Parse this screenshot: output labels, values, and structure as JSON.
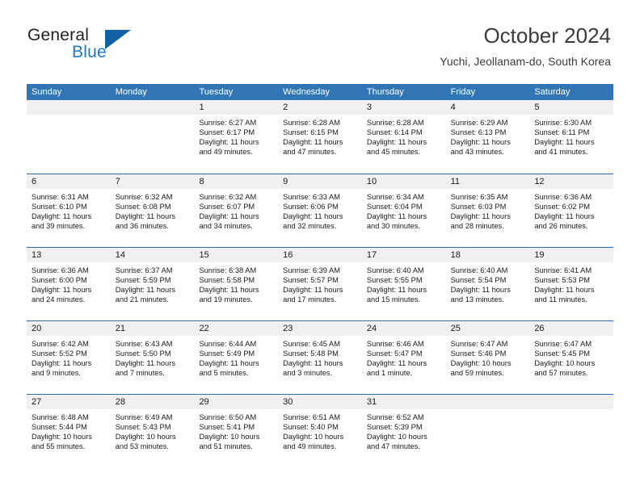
{
  "logo": {
    "word_top": "General",
    "word_bottom": "Blue",
    "triangle_color": "#1362a6",
    "blue_color": "#1c79c0"
  },
  "header": {
    "title": "October 2024",
    "subtitle": "Yuchi, Jeollanam-do, South Korea",
    "accent_color": "#3275b5"
  },
  "weekday_headers": [
    "Sunday",
    "Monday",
    "Tuesday",
    "Wednesday",
    "Thursday",
    "Friday",
    "Saturday"
  ],
  "weeks": [
    [
      {
        "day": "",
        "sunrise": "",
        "sunset": "",
        "daylight_line1": "",
        "daylight_line2": "",
        "empty": true
      },
      {
        "day": "",
        "sunrise": "",
        "sunset": "",
        "daylight_line1": "",
        "daylight_line2": "",
        "empty": true
      },
      {
        "day": "1",
        "sunrise": "Sunrise: 6:27 AM",
        "sunset": "Sunset: 6:17 PM",
        "daylight_line1": "Daylight: 11 hours",
        "daylight_line2": "and 49 minutes."
      },
      {
        "day": "2",
        "sunrise": "Sunrise: 6:28 AM",
        "sunset": "Sunset: 6:15 PM",
        "daylight_line1": "Daylight: 11 hours",
        "daylight_line2": "and 47 minutes."
      },
      {
        "day": "3",
        "sunrise": "Sunrise: 6:28 AM",
        "sunset": "Sunset: 6:14 PM",
        "daylight_line1": "Daylight: 11 hours",
        "daylight_line2": "and 45 minutes."
      },
      {
        "day": "4",
        "sunrise": "Sunrise: 6:29 AM",
        "sunset": "Sunset: 6:13 PM",
        "daylight_line1": "Daylight: 11 hours",
        "daylight_line2": "and 43 minutes."
      },
      {
        "day": "5",
        "sunrise": "Sunrise: 6:30 AM",
        "sunset": "Sunset: 6:11 PM",
        "daylight_line1": "Daylight: 11 hours",
        "daylight_line2": "and 41 minutes."
      }
    ],
    [
      {
        "day": "6",
        "sunrise": "Sunrise: 6:31 AM",
        "sunset": "Sunset: 6:10 PM",
        "daylight_line1": "Daylight: 11 hours",
        "daylight_line2": "and 39 minutes."
      },
      {
        "day": "7",
        "sunrise": "Sunrise: 6:32 AM",
        "sunset": "Sunset: 6:08 PM",
        "daylight_line1": "Daylight: 11 hours",
        "daylight_line2": "and 36 minutes."
      },
      {
        "day": "8",
        "sunrise": "Sunrise: 6:32 AM",
        "sunset": "Sunset: 6:07 PM",
        "daylight_line1": "Daylight: 11 hours",
        "daylight_line2": "and 34 minutes."
      },
      {
        "day": "9",
        "sunrise": "Sunrise: 6:33 AM",
        "sunset": "Sunset: 6:06 PM",
        "daylight_line1": "Daylight: 11 hours",
        "daylight_line2": "and 32 minutes."
      },
      {
        "day": "10",
        "sunrise": "Sunrise: 6:34 AM",
        "sunset": "Sunset: 6:04 PM",
        "daylight_line1": "Daylight: 11 hours",
        "daylight_line2": "and 30 minutes."
      },
      {
        "day": "11",
        "sunrise": "Sunrise: 6:35 AM",
        "sunset": "Sunset: 6:03 PM",
        "daylight_line1": "Daylight: 11 hours",
        "daylight_line2": "and 28 minutes."
      },
      {
        "day": "12",
        "sunrise": "Sunrise: 6:36 AM",
        "sunset": "Sunset: 6:02 PM",
        "daylight_line1": "Daylight: 11 hours",
        "daylight_line2": "and 26 minutes."
      }
    ],
    [
      {
        "day": "13",
        "sunrise": "Sunrise: 6:36 AM",
        "sunset": "Sunset: 6:00 PM",
        "daylight_line1": "Daylight: 11 hours",
        "daylight_line2": "and 24 minutes."
      },
      {
        "day": "14",
        "sunrise": "Sunrise: 6:37 AM",
        "sunset": "Sunset: 5:59 PM",
        "daylight_line1": "Daylight: 11 hours",
        "daylight_line2": "and 21 minutes."
      },
      {
        "day": "15",
        "sunrise": "Sunrise: 6:38 AM",
        "sunset": "Sunset: 5:58 PM",
        "daylight_line1": "Daylight: 11 hours",
        "daylight_line2": "and 19 minutes."
      },
      {
        "day": "16",
        "sunrise": "Sunrise: 6:39 AM",
        "sunset": "Sunset: 5:57 PM",
        "daylight_line1": "Daylight: 11 hours",
        "daylight_line2": "and 17 minutes."
      },
      {
        "day": "17",
        "sunrise": "Sunrise: 6:40 AM",
        "sunset": "Sunset: 5:55 PM",
        "daylight_line1": "Daylight: 11 hours",
        "daylight_line2": "and 15 minutes."
      },
      {
        "day": "18",
        "sunrise": "Sunrise: 6:40 AM",
        "sunset": "Sunset: 5:54 PM",
        "daylight_line1": "Daylight: 11 hours",
        "daylight_line2": "and 13 minutes."
      },
      {
        "day": "19",
        "sunrise": "Sunrise: 6:41 AM",
        "sunset": "Sunset: 5:53 PM",
        "daylight_line1": "Daylight: 11 hours",
        "daylight_line2": "and 11 minutes."
      }
    ],
    [
      {
        "day": "20",
        "sunrise": "Sunrise: 6:42 AM",
        "sunset": "Sunset: 5:52 PM",
        "daylight_line1": "Daylight: 11 hours",
        "daylight_line2": "and 9 minutes."
      },
      {
        "day": "21",
        "sunrise": "Sunrise: 6:43 AM",
        "sunset": "Sunset: 5:50 PM",
        "daylight_line1": "Daylight: 11 hours",
        "daylight_line2": "and 7 minutes."
      },
      {
        "day": "22",
        "sunrise": "Sunrise: 6:44 AM",
        "sunset": "Sunset: 5:49 PM",
        "daylight_line1": "Daylight: 11 hours",
        "daylight_line2": "and 5 minutes."
      },
      {
        "day": "23",
        "sunrise": "Sunrise: 6:45 AM",
        "sunset": "Sunset: 5:48 PM",
        "daylight_line1": "Daylight: 11 hours",
        "daylight_line2": "and 3 minutes."
      },
      {
        "day": "24",
        "sunrise": "Sunrise: 6:46 AM",
        "sunset": "Sunset: 5:47 PM",
        "daylight_line1": "Daylight: 11 hours",
        "daylight_line2": "and 1 minute."
      },
      {
        "day": "25",
        "sunrise": "Sunrise: 6:47 AM",
        "sunset": "Sunset: 5:46 PM",
        "daylight_line1": "Daylight: 10 hours",
        "daylight_line2": "and 59 minutes."
      },
      {
        "day": "26",
        "sunrise": "Sunrise: 6:47 AM",
        "sunset": "Sunset: 5:45 PM",
        "daylight_line1": "Daylight: 10 hours",
        "daylight_line2": "and 57 minutes."
      }
    ],
    [
      {
        "day": "27",
        "sunrise": "Sunrise: 6:48 AM",
        "sunset": "Sunset: 5:44 PM",
        "daylight_line1": "Daylight: 10 hours",
        "daylight_line2": "and 55 minutes."
      },
      {
        "day": "28",
        "sunrise": "Sunrise: 6:49 AM",
        "sunset": "Sunset: 5:43 PM",
        "daylight_line1": "Daylight: 10 hours",
        "daylight_line2": "and 53 minutes."
      },
      {
        "day": "29",
        "sunrise": "Sunrise: 6:50 AM",
        "sunset": "Sunset: 5:41 PM",
        "daylight_line1": "Daylight: 10 hours",
        "daylight_line2": "and 51 minutes."
      },
      {
        "day": "30",
        "sunrise": "Sunrise: 6:51 AM",
        "sunset": "Sunset: 5:40 PM",
        "daylight_line1": "Daylight: 10 hours",
        "daylight_line2": "and 49 minutes."
      },
      {
        "day": "31",
        "sunrise": "Sunrise: 6:52 AM",
        "sunset": "Sunset: 5:39 PM",
        "daylight_line1": "Daylight: 10 hours",
        "daylight_line2": "and 47 minutes."
      },
      {
        "day": "",
        "sunrise": "",
        "sunset": "",
        "daylight_line1": "",
        "daylight_line2": "",
        "empty": true
      },
      {
        "day": "",
        "sunrise": "",
        "sunset": "",
        "daylight_line1": "",
        "daylight_line2": "",
        "empty": true
      }
    ]
  ]
}
